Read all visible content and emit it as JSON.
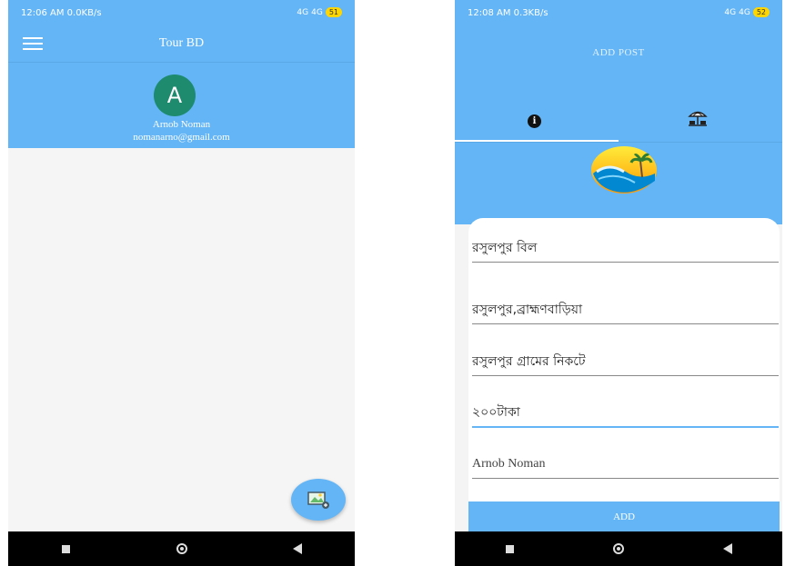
{
  "left_screen": {
    "status": {
      "time": "12:06 AM",
      "speed": "0.0KB/s",
      "network": "4G",
      "network2": "4G",
      "battery": "51"
    },
    "app_title": "Tour BD",
    "profile": {
      "avatar_letter": "A",
      "name": "Arnob Noman",
      "email": "nomanarno@gmail.com"
    },
    "fab_icon": "add-photo-icon"
  },
  "right_screen": {
    "status": {
      "time": "12:08 AM",
      "speed": "0.3KB/s",
      "network": "4G",
      "network2": "4G",
      "battery": "52"
    },
    "page_title": "ADD POST",
    "tabs": [
      {
        "icon": "info-icon"
      },
      {
        "icon": "beach-umbrella-icon"
      }
    ],
    "fields": [
      {
        "value": "রসুলপুর বিল"
      },
      {
        "value": "রসুলপুর,ব্রাহ্মণবাড়িয়া"
      },
      {
        "value": "রসুলপুর গ্রামের নিকটে"
      },
      {
        "value": "২০০টাকা"
      },
      {
        "value": "Arnob Noman"
      }
    ],
    "add_button": "ADD"
  },
  "colors": {
    "primary": "#64b5f6",
    "avatar": "#1e8a6e",
    "navbar": "#000000"
  }
}
